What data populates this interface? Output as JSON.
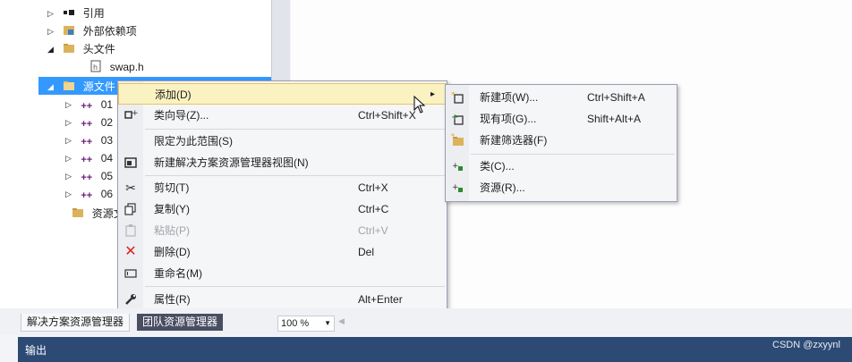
{
  "tree": {
    "items": [
      {
        "label": "引用",
        "icon": "references-icon",
        "arrow": "▷"
      },
      {
        "label": "外部依赖项",
        "icon": "external-deps-icon",
        "arrow": "▷"
      },
      {
        "label": "头文件",
        "icon": "folder-icon",
        "arrow": "◢"
      },
      {
        "label": "swap.h",
        "icon": "header-file-icon",
        "arrow": ""
      },
      {
        "label": "源文件",
        "icon": "folder-icon",
        "arrow": "◢",
        "selected": true
      },
      {
        "label": "01",
        "icon": "cpp-file-icon",
        "arrow": "▷"
      },
      {
        "label": "02",
        "icon": "cpp-file-icon",
        "arrow": "▷"
      },
      {
        "label": "03",
        "icon": "cpp-file-icon",
        "arrow": "▷"
      },
      {
        "label": "04",
        "icon": "cpp-file-icon",
        "arrow": "▷"
      },
      {
        "label": "05",
        "icon": "cpp-file-icon",
        "arrow": "▷"
      },
      {
        "label": "06",
        "icon": "cpp-file-icon",
        "arrow": "▷"
      },
      {
        "label": "资源文",
        "icon": "folder-icon",
        "arrow": ""
      }
    ],
    "cpp_glyph": "++"
  },
  "context_menu": {
    "items": [
      {
        "label": "添加(D)",
        "shortcut": "",
        "icon": "",
        "highlighted": true,
        "submenu": "▸"
      },
      {
        "label": "类向导(Z)...",
        "shortcut": "Ctrl+Shift+X",
        "icon": "class-wizard-icon"
      },
      {
        "label": "限定为此范围(S)",
        "shortcut": "",
        "icon": ""
      },
      {
        "label": "新建解决方案资源管理器视图(N)",
        "shortcut": "",
        "icon": "new-view-icon"
      },
      {
        "label": "剪切(T)",
        "shortcut": "Ctrl+X",
        "icon": "cut-icon"
      },
      {
        "label": "复制(Y)",
        "shortcut": "Ctrl+C",
        "icon": "copy-icon"
      },
      {
        "label": "粘贴(P)",
        "shortcut": "Ctrl+V",
        "icon": "paste-icon",
        "disabled": true
      },
      {
        "label": "删除(D)",
        "shortcut": "Del",
        "icon": "delete-icon"
      },
      {
        "label": "重命名(M)",
        "shortcut": "",
        "icon": "rename-icon"
      },
      {
        "label": "属性(R)",
        "shortcut": "Alt+Enter",
        "icon": "properties-icon"
      }
    ]
  },
  "submenu": {
    "items": [
      {
        "label": "新建项(W)...",
        "shortcut": "Ctrl+Shift+A",
        "icon": "new-item-icon"
      },
      {
        "label": "现有项(G)...",
        "shortcut": "Shift+Alt+A",
        "icon": "existing-item-icon"
      },
      {
        "label": "新建筛选器(F)",
        "shortcut": "",
        "icon": "new-filter-icon"
      },
      {
        "label": "类(C)...",
        "shortcut": "",
        "icon": "class-icon"
      },
      {
        "label": "资源(R)...",
        "shortcut": "",
        "icon": "resource-icon"
      }
    ]
  },
  "bottom_tabs": {
    "solution_explorer": "解决方案资源管理器",
    "team_explorer": "团队资源管理器"
  },
  "zoom": {
    "value": "100 %"
  },
  "output_panel": {
    "title": "输出"
  },
  "watermark": "CSDN @zxyynl",
  "colors": {
    "selection": "#3399ff",
    "menu_highlight": "#fbf2c2",
    "output_bar": "#2d4a74",
    "delete_red": "#d9251c"
  }
}
